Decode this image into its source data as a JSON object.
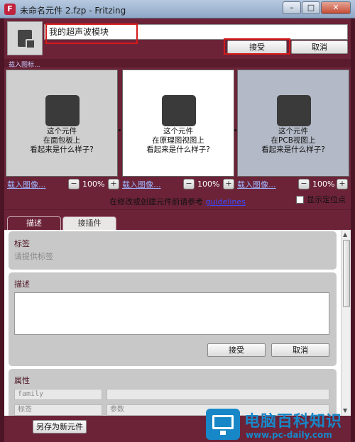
{
  "window": {
    "title": "未命名元件 2.fzp - Fritzing",
    "app_icon": "F",
    "minimize": "–",
    "maximize": "□",
    "close": "✕"
  },
  "header": {
    "name_value": "我的超声波模块",
    "accept_label": "接受",
    "cancel_label": "取消",
    "load_image_label": "载入图标..."
  },
  "views": [
    {
      "line1": "这个元件",
      "line2": "在面包板上",
      "line3": "看起来是什么样子?",
      "load_label": "载入图像...",
      "zoom": "100%",
      "bg": "#cfcfcf"
    },
    {
      "line1": "这个元件",
      "line2": "在原理图视图上",
      "line3": "看起来是什么样子?",
      "load_label": "载入图像...",
      "zoom": "100%",
      "bg": "#ffffff"
    },
    {
      "line1": "这个元件",
      "line2": "在PCB视图上",
      "line3": "看起来是什么样子?",
      "load_label": "载入图像...",
      "zoom": "100%",
      "bg": "#b3b9c6"
    }
  ],
  "guidelines": {
    "prefix": "在修改或创建元件前请参考",
    "link": "guidelines"
  },
  "show_location_label": "显示定位点",
  "tabs": [
    {
      "label": "描述"
    },
    {
      "label": "接插件"
    }
  ],
  "tags_group": {
    "title": "标签",
    "placeholder": "请提供标签"
  },
  "description_group": {
    "title": "描述",
    "accept_label": "接受",
    "cancel_label": "取消"
  },
  "properties_group": {
    "title": "属性",
    "rows": [
      {
        "key": "family",
        "value": ""
      },
      {
        "key": "标签",
        "value": "参数"
      }
    ]
  },
  "footer": {
    "save_as_label": "另存为新元件"
  },
  "watermark": {
    "title": "电脑百科知识",
    "url": "www.pc-daily.com"
  },
  "colors": {
    "accent": "#6c2338",
    "highlight_box": "#d41a1a",
    "link": "#3a4bff"
  }
}
